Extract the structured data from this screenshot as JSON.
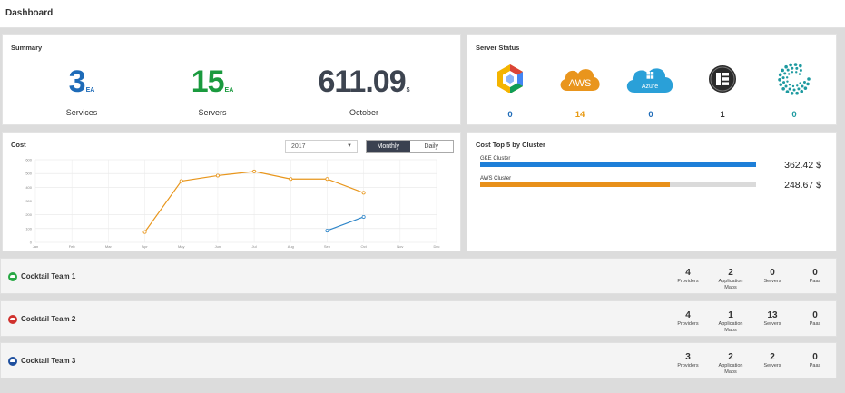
{
  "header": {
    "title": "Dashboard"
  },
  "summary": {
    "title": "Summary",
    "items": [
      {
        "value": "3",
        "unit": "EA",
        "label": "Services",
        "color": "#1e6bb8"
      },
      {
        "value": "15",
        "unit": "EA",
        "label": "Servers",
        "color": "#1a9a3e"
      },
      {
        "value": "611.09",
        "unit": "$",
        "label": "October",
        "color": "#3d4450"
      }
    ]
  },
  "server_status": {
    "title": "Server Status",
    "providers": [
      {
        "icon": "gke-hexagon-icon",
        "count": "0",
        "count_color": "#1e6bb8"
      },
      {
        "icon": "aws-cloud-icon",
        "label": "AWS",
        "count": "14",
        "count_color": "#e89a13"
      },
      {
        "icon": "azure-cloud-icon",
        "label": "Azure",
        "count": "0",
        "count_color": "#1e6bb8"
      },
      {
        "icon": "datacenter-server-icon",
        "count": "1",
        "count_color": "#333333"
      },
      {
        "icon": "dotted-ring-icon",
        "count": "0",
        "count_color": "#1e9aa0"
      }
    ]
  },
  "cost": {
    "title": "Cost",
    "year_select": "2017",
    "toggle": {
      "monthly": "Monthly",
      "daily": "Daily",
      "selected": "Monthly"
    }
  },
  "chart_data": {
    "type": "line",
    "categories": [
      "Jan",
      "Feb",
      "Mar",
      "Apr",
      "May",
      "Jun",
      "Jul",
      "Aug",
      "Sep",
      "Oct",
      "Nov",
      "Dec"
    ],
    "yticks": [
      0,
      100,
      200,
      300,
      400,
      500,
      600
    ],
    "ylim": [
      0,
      600
    ],
    "grid": true,
    "series": [
      {
        "color": "#e8961c",
        "values": [
          null,
          null,
          null,
          75,
          445,
          485,
          515,
          460,
          460,
          360,
          null,
          null
        ]
      },
      {
        "color": "#2f86c9",
        "values": [
          null,
          null,
          null,
          null,
          null,
          null,
          null,
          null,
          85,
          185,
          null,
          null
        ]
      }
    ]
  },
  "clusters": {
    "title": "Cost Top 5 by Cluster",
    "items": [
      {
        "name": "GKE Cluster",
        "value": "362.42 $",
        "fraction": 1.0,
        "color": "#1e7fd8"
      },
      {
        "name": "AWS Cluster",
        "value": "248.67 $",
        "fraction": 0.686,
        "color": "#e8901a"
      }
    ]
  },
  "teams": [
    {
      "name": "Cocktail Team 1",
      "icon_color": "#27a844",
      "providers": "4",
      "maps": "2",
      "servers": "0",
      "paas": "0"
    },
    {
      "name": "Cocktail Team 2",
      "icon_color": "#d0312d",
      "providers": "4",
      "maps": "1",
      "servers": "13",
      "paas": "0"
    },
    {
      "name": "Cocktail Team 3",
      "icon_color": "#1e4f9e",
      "providers": "3",
      "maps": "2",
      "servers": "2",
      "paas": "0"
    }
  ],
  "team_labels": {
    "providers": "Providers",
    "maps_line1": "Application",
    "maps_line2": "Maps",
    "servers": "Servers",
    "paas": "Paas"
  }
}
